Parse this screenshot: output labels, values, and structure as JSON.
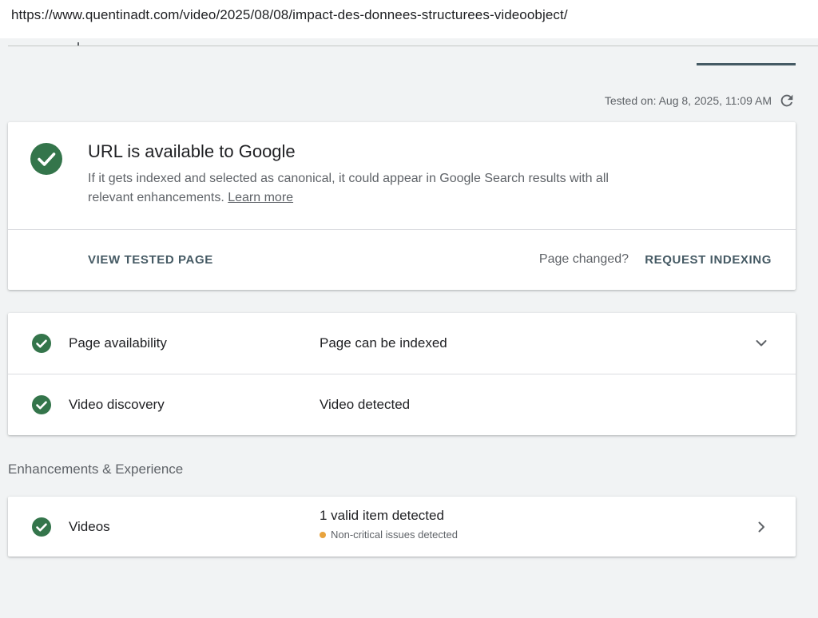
{
  "browser": {
    "url": "https://www.quentinadt.com/video/2025/08/08/impact-des-donnees-structurees-videoobject/"
  },
  "header": {
    "tested_on": "Tested on: Aug 8, 2025, 11:09 AM",
    "refresh_icon": "refresh-icon"
  },
  "summary": {
    "status_icon": "check-circle-icon",
    "title": "URL is available to Google",
    "description": "If it gets indexed and selected as canonical, it could appear in Google Search results with all relevant enhancements.",
    "learn_more": "Learn more",
    "view_tested_page": "VIEW TESTED PAGE",
    "page_changed": "Page changed?",
    "request_indexing": "REQUEST INDEXING"
  },
  "checks": [
    {
      "label": "Page availability",
      "value": "Page can be indexed",
      "icon": "check-circle-icon",
      "action_icon": "chevron-down-icon"
    },
    {
      "label": "Video discovery",
      "value": "Video detected",
      "icon": "check-circle-icon"
    }
  ],
  "enhancements": {
    "section_title": "Enhancements & Experience",
    "items": [
      {
        "label": "Videos",
        "value": "1 valid item detected",
        "note": "Non-critical issues detected",
        "icon": "check-circle-icon",
        "action_icon": "chevron-right-icon"
      }
    ]
  },
  "colors": {
    "success": "#34754b",
    "warning": "#e8a33d",
    "accent": "#455a64"
  }
}
